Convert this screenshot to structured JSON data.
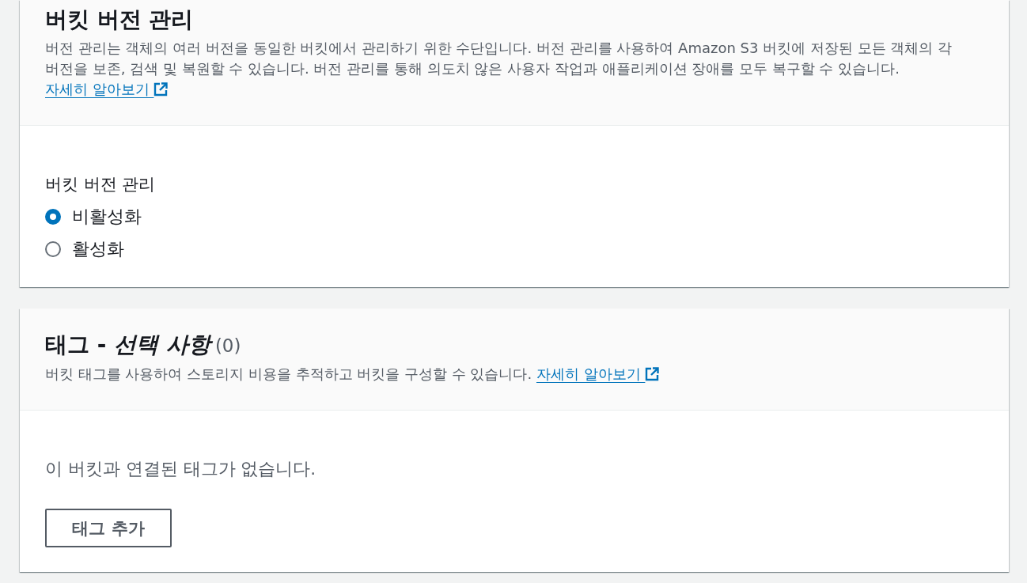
{
  "versioning_section": {
    "title": "버킷 버전 관리",
    "description": "버전 관리는 객체의 여러 버전을 동일한 버킷에서 관리하기 위한 수단입니다. 버전 관리를 사용하여 Amazon S3 버킷에 저장된 모든 객체의 각 버전을 보존, 검색 및 복원할 수 있습니다. 버전 관리를 통해 의도치 않은 사용자 작업과 애플리케이션 장애를 모두 복구할 수 있습니다.",
    "link": "자세히 알아보기",
    "field_label": "버킷 버전 관리",
    "options": [
      {
        "label": "비활성화",
        "selected": true
      },
      {
        "label": "활성화",
        "selected": false
      }
    ]
  },
  "tags_section": {
    "title": "태그 - *선택 사항*",
    "count": "(0)",
    "description": "버킷 태그를 사용하여 스토리지 비용을 추적하고 버킷을 구성할 수 있습니다.",
    "link": "자세히 알아보기",
    "empty_text": "이 버킷과 연결된 태그가 없습니다.",
    "button": "태그 추가"
  }
}
